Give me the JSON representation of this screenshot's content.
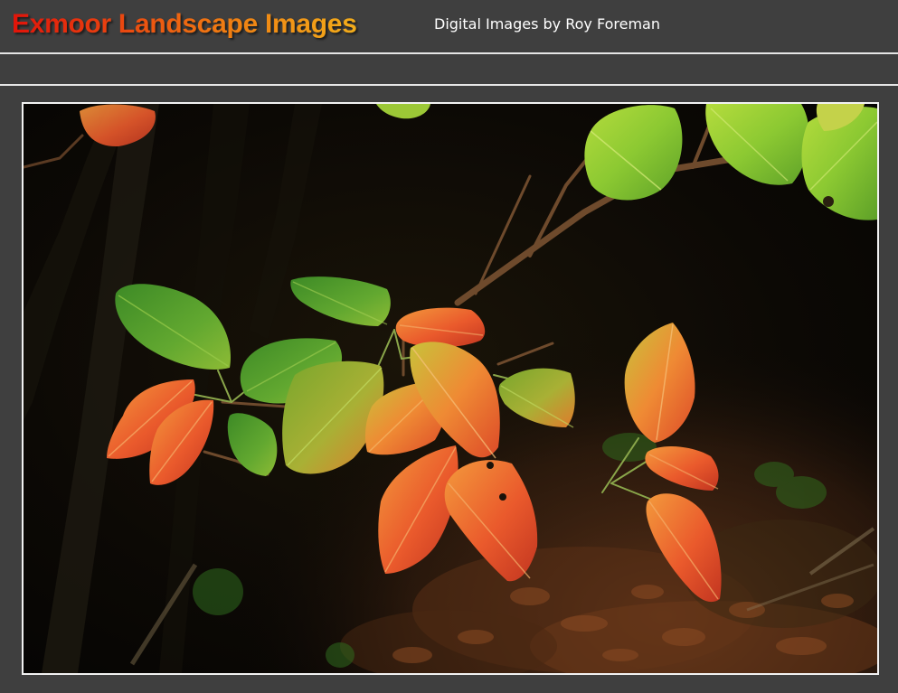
{
  "site": {
    "title": "Exmoor Landscape Images",
    "subtitle": "Digital Images by Roy Foreman"
  },
  "photo": {
    "subject": "autumn-leaves-photo"
  },
  "colors": {
    "page_background": "#3f3f3f",
    "divider": "#e6e6e6",
    "frame_border": "#f2f2f2",
    "title_gradient_start": "#e1140a",
    "title_gradient_end": "#f3ad1a",
    "subtitle_text": "#ffffff"
  }
}
